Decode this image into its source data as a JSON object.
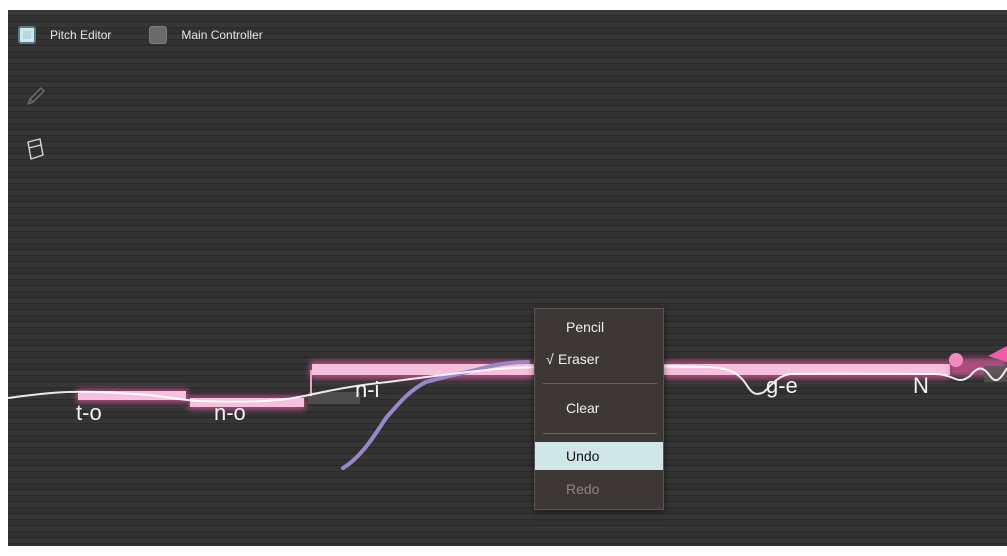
{
  "tabs": [
    {
      "label": "Pitch Editor",
      "checked": true
    },
    {
      "label": "Main Controller",
      "checked": false
    }
  ],
  "tools": [
    {
      "icon": "pencil-icon",
      "enabled": false
    },
    {
      "icon": "eraser-icon",
      "enabled": true
    }
  ],
  "syllables": [
    "t-o",
    "n-o",
    "n-i",
    "g-e",
    "N"
  ],
  "colors": {
    "note_bar": "#ee5da8",
    "pitch_curve": "#ffffff",
    "drawn_curve": "#9a88c6",
    "menu_bg": "#3d3736",
    "menu_highlight": "#cfe5e6"
  },
  "context_menu": {
    "items": [
      {
        "label": "Pencil",
        "checked": false,
        "state": "normal"
      },
      {
        "label": "Eraser",
        "checked": true,
        "state": "normal"
      },
      {
        "label": "Clear",
        "checked": false,
        "state": "normal"
      },
      {
        "label": "Undo",
        "checked": false,
        "state": "highlighted"
      },
      {
        "label": "Redo",
        "checked": false,
        "state": "disabled"
      }
    ],
    "checkmark": "√"
  }
}
